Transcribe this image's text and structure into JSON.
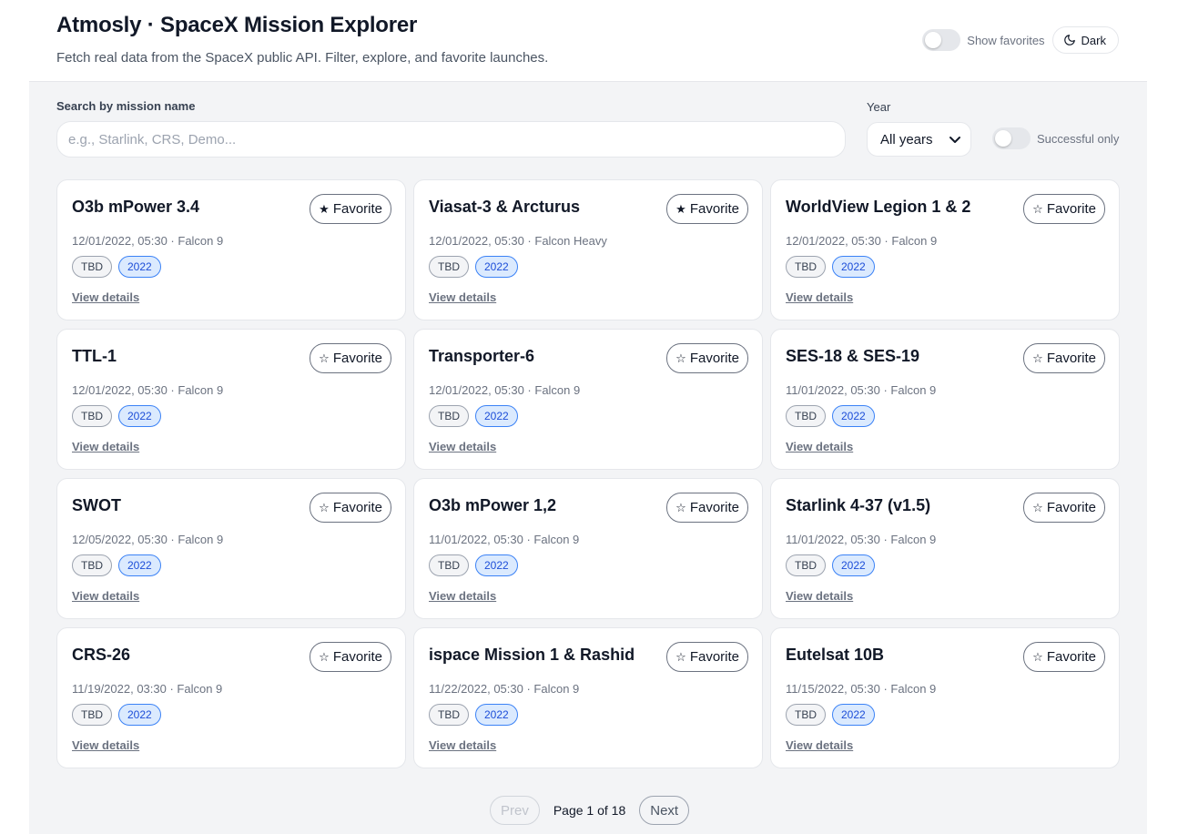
{
  "header": {
    "title": "Atmosly · SpaceX Mission Explorer",
    "subtitle": "Fetch real data from the SpaceX public API. Filter, explore, and favorite launches.",
    "show_favorites_label": "Show favorites",
    "theme_button_label": "Dark",
    "theme_icon": "moon-icon"
  },
  "filters": {
    "search_label": "Search by mission name",
    "search_placeholder": "e.g., Starlink, CRS, Demo...",
    "search_value": "",
    "year_label": "Year",
    "year_selected": "All years",
    "successful_only_label": "Successful only"
  },
  "colors": {
    "page_bg": "#f3f4f6",
    "card_bg": "#ffffff",
    "year_badge_bg": "#dbeafe",
    "year_badge_border": "#3b82f6"
  },
  "launches": [
    {
      "name": "O3b mPower 3.4",
      "meta": "12/01/2022, 05:30 · Falcon 9",
      "status": "TBD",
      "year": "2022",
      "favorite_label": "Favorite",
      "favorited": true,
      "details_label": "View details"
    },
    {
      "name": "Viasat-3 & Arcturus",
      "meta": "12/01/2022, 05:30 · Falcon Heavy",
      "status": "TBD",
      "year": "2022",
      "favorite_label": "Favorite",
      "favorited": true,
      "details_label": "View details"
    },
    {
      "name": "WorldView Legion 1 & 2",
      "meta": "12/01/2022, 05:30 · Falcon 9",
      "status": "TBD",
      "year": "2022",
      "favorite_label": "Favorite",
      "favorited": false,
      "details_label": "View details"
    },
    {
      "name": "TTL-1",
      "meta": "12/01/2022, 05:30 · Falcon 9",
      "status": "TBD",
      "year": "2022",
      "favorite_label": "Favorite",
      "favorited": false,
      "details_label": "View details"
    },
    {
      "name": "Transporter-6",
      "meta": "12/01/2022, 05:30 · Falcon 9",
      "status": "TBD",
      "year": "2022",
      "favorite_label": "Favorite",
      "favorited": false,
      "details_label": "View details"
    },
    {
      "name": "SES-18 & SES-19",
      "meta": "11/01/2022, 05:30 · Falcon 9",
      "status": "TBD",
      "year": "2022",
      "favorite_label": "Favorite",
      "favorited": false,
      "details_label": "View details"
    },
    {
      "name": "SWOT",
      "meta": "12/05/2022, 05:30 · Falcon 9",
      "status": "TBD",
      "year": "2022",
      "favorite_label": "Favorite",
      "favorited": false,
      "details_label": "View details"
    },
    {
      "name": "O3b mPower 1,2",
      "meta": "11/01/2022, 05:30 · Falcon 9",
      "status": "TBD",
      "year": "2022",
      "favorite_label": "Favorite",
      "favorited": false,
      "details_label": "View details"
    },
    {
      "name": "Starlink 4-37 (v1.5)",
      "meta": "11/01/2022, 05:30 · Falcon 9",
      "status": "TBD",
      "year": "2022",
      "favorite_label": "Favorite",
      "favorited": false,
      "details_label": "View details"
    },
    {
      "name": "CRS-26",
      "meta": "11/19/2022, 03:30 · Falcon 9",
      "status": "TBD",
      "year": "2022",
      "favorite_label": "Favorite",
      "favorited": false,
      "details_label": "View details"
    },
    {
      "name": "ispace Mission 1 & Rashid",
      "meta": "11/22/2022, 05:30 · Falcon 9",
      "status": "TBD",
      "year": "2022",
      "favorite_label": "Favorite",
      "favorited": false,
      "details_label": "View details"
    },
    {
      "name": "Eutelsat 10B",
      "meta": "11/15/2022, 05:30 · Falcon 9",
      "status": "TBD",
      "year": "2022",
      "favorite_label": "Favorite",
      "favorited": false,
      "details_label": "View details"
    }
  ],
  "pagination": {
    "prev_label": "Prev",
    "next_label": "Next",
    "page_info": "Page 1 of 18"
  }
}
